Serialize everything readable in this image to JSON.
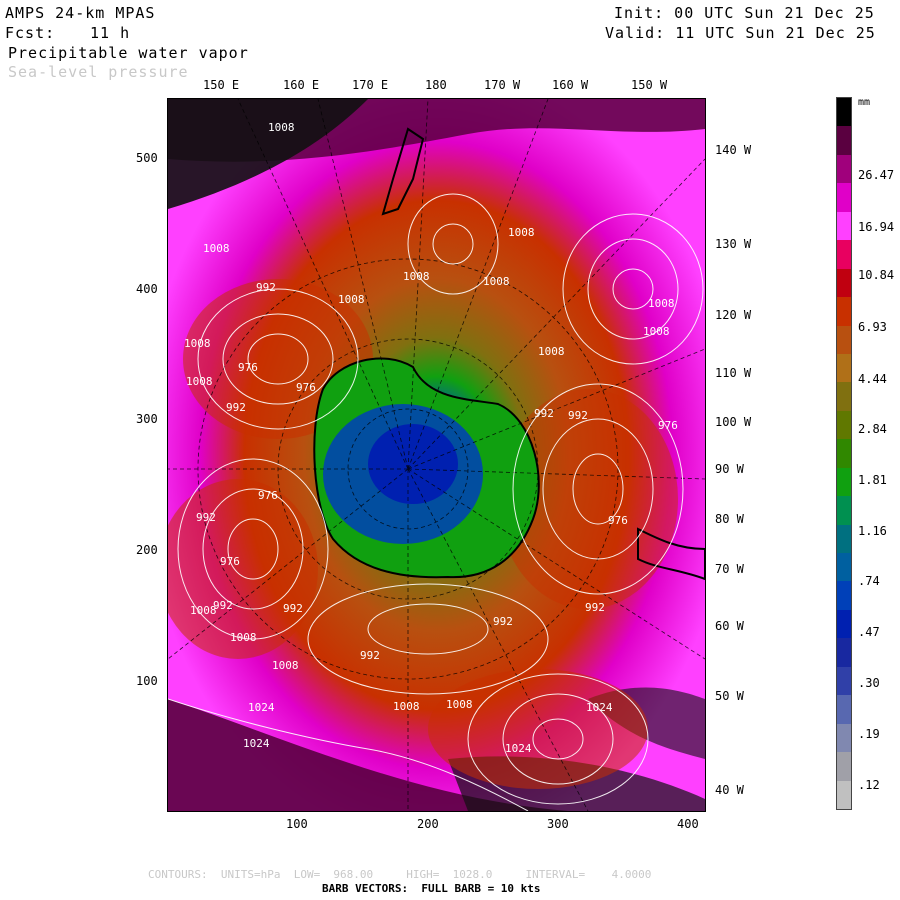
{
  "header": {
    "model": "AMPS 24-km MPAS",
    "fcst_label": "Fcst:",
    "fcst_value": "11 h",
    "field1": "Precipitable water vapor",
    "field2": "Sea-level pressure",
    "init": "Init: 00 UTC Sun 21 Dec 25",
    "valid": "Valid: 11 UTC Sun 21 Dec 25"
  },
  "top_lon_labels": [
    "150 E",
    "160 E",
    "170 E",
    "180",
    "170 W",
    "160 W",
    "150 W"
  ],
  "right_lon_labels": [
    "140 W",
    "130 W",
    "120 W",
    "110 W",
    "100 W",
    "90 W",
    "80 W",
    "70 W",
    "60 W",
    "50 W",
    "40 W"
  ],
  "y_axis": [
    "500",
    "400",
    "300",
    "200",
    "100"
  ],
  "x_axis": [
    "100",
    "200",
    "300",
    "400"
  ],
  "contour_labels": [
    "1008",
    "1008",
    "992",
    "1008",
    "1008",
    "1008",
    "1008",
    "1008",
    "976",
    "1008",
    "976",
    "992",
    "1008",
    "976",
    "992",
    "992",
    "1008",
    "1008",
    "976",
    "992",
    "976",
    "992",
    "976",
    "1008",
    "992",
    "992",
    "1008",
    "992",
    "1008",
    "992",
    "1024",
    "1008",
    "1008",
    "1024",
    "1024",
    "1024"
  ],
  "colorbar": {
    "units": "mm",
    "labels": [
      "26.47",
      "16.94",
      "10.84",
      "6.93",
      "4.44",
      "2.84",
      "1.81",
      "1.16",
      ".74",
      ".47",
      ".30",
      ".19",
      ".12"
    ],
    "colors": [
      "#000000",
      "#5a0040",
      "#a0007c",
      "#e000c8",
      "#ff40ff",
      "#e80060",
      "#c00010",
      "#c83000",
      "#b85010",
      "#b07018",
      "#807010",
      "#607800",
      "#308800",
      "#10a010",
      "#009050",
      "#007080",
      "#0060a0",
      "#0040b8",
      "#0020b0",
      "#1828a0",
      "#3040a8",
      "#5868b0",
      "#8088b0",
      "#a0a0a8",
      "#c0c0c0"
    ]
  },
  "footer": {
    "contours": "CONTOURS:  UNITS=hPa  LOW=  968.00     HIGH=  1028.0     INTERVAL=    4.0000",
    "barbs": "BARB VECTORS:  FULL BARB = 10 kts"
  }
}
